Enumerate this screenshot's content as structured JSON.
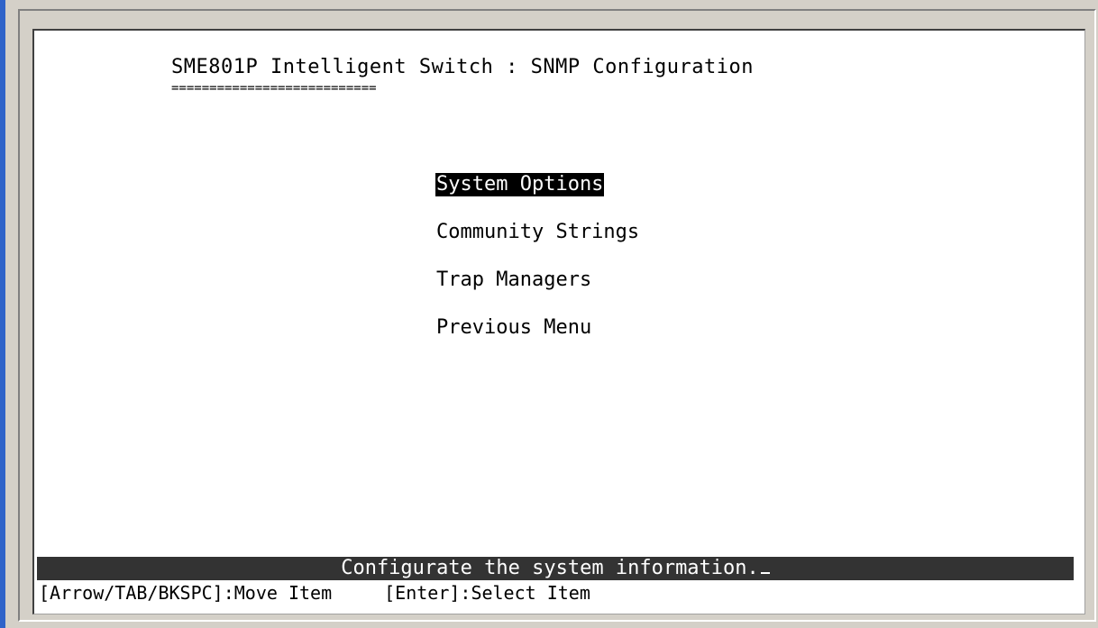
{
  "header": {
    "title": "SME801P Intelligent Switch : SNMP Configuration",
    "underline": "==========================="
  },
  "menu": {
    "items": [
      {
        "label": "System Options",
        "selected": true
      },
      {
        "label": "Community Strings",
        "selected": false
      },
      {
        "label": "Trap Managers",
        "selected": false
      },
      {
        "label": "Previous Menu",
        "selected": false
      }
    ]
  },
  "status": {
    "message": "Configurate the system information."
  },
  "help": {
    "move": "[Arrow/TAB/BKSPC]:Move Item",
    "select": "[Enter]:Select Item"
  },
  "colors": {
    "window_border_accent": "#2f63c9",
    "screen_background": "#ffffff",
    "status_bar_background": "#333333",
    "selected_background": "#000000"
  }
}
